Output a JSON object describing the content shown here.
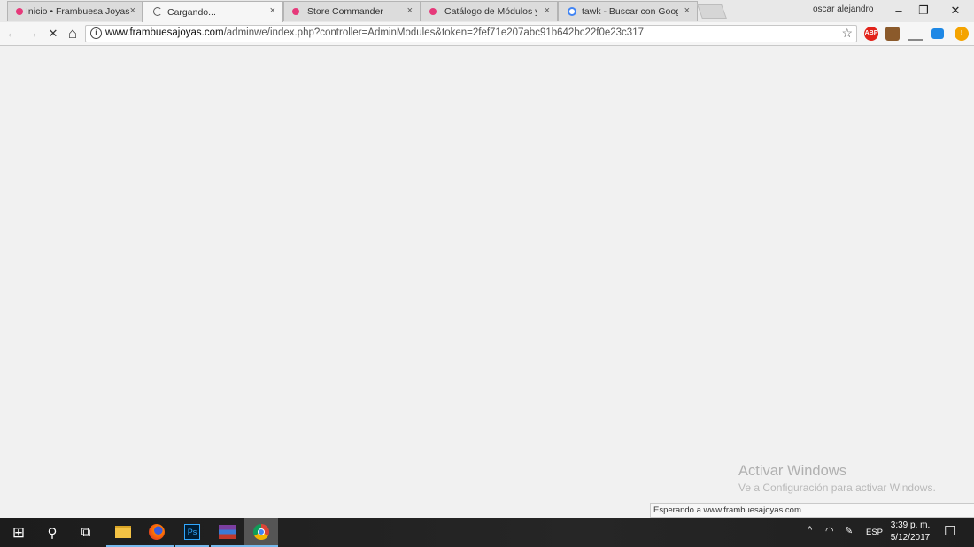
{
  "tabs": [
    {
      "title": "Inicio • Frambuesa Joyas",
      "fav_color": "#e6397a"
    },
    {
      "title": "Cargando...",
      "fav_color": "#555555"
    },
    {
      "title": "Store Commander",
      "fav_color": "#e6397a"
    },
    {
      "title": "Catálogo de Módulos y T",
      "fav_color": "#e6397a"
    },
    {
      "title": "tawk - Buscar con Googl",
      "fav_color": "#4285f4"
    }
  ],
  "close_glyph": "×",
  "user": {
    "name": "oscar alejandro"
  },
  "window": {
    "minimize": "–",
    "restore": "❐",
    "close": "✕"
  },
  "toolbar": {
    "back": "←",
    "forward": "→",
    "stop": "✕",
    "home": "⌂",
    "url_host": "www.frambuesajoyas.com",
    "url_path": "/adminwe/index.php?controller=AdminModules&token=2fef71e207abc91b642bc22f0e23c317",
    "star": "☆",
    "extensions": [
      {
        "name": "abp-icon",
        "label": "ABP",
        "color": "#e2231a"
      },
      {
        "name": "user-avatar-icon",
        "label": "",
        "color": "#8b5a2b"
      },
      {
        "name": "inbox-icon",
        "label": "",
        "color": "#888888"
      },
      {
        "name": "extension-blue-icon",
        "label": "",
        "color": "#1e88e5"
      },
      {
        "name": "warning-icon",
        "label": "!",
        "color": "#f4a300"
      }
    ]
  },
  "content": {
    "watermark_title": "Activar Windows",
    "watermark_sub": "Ve a Configuración para activar Windows.",
    "status_text": "Esperando a www.frambuesajoyas.com..."
  },
  "taskbar": {
    "start": "⊞",
    "search": "⚲",
    "taskview": "⧉",
    "tray_up": "^",
    "language": "ESP",
    "time": "3:39 p. m.",
    "date": "5/12/2017",
    "notification": "☐"
  }
}
